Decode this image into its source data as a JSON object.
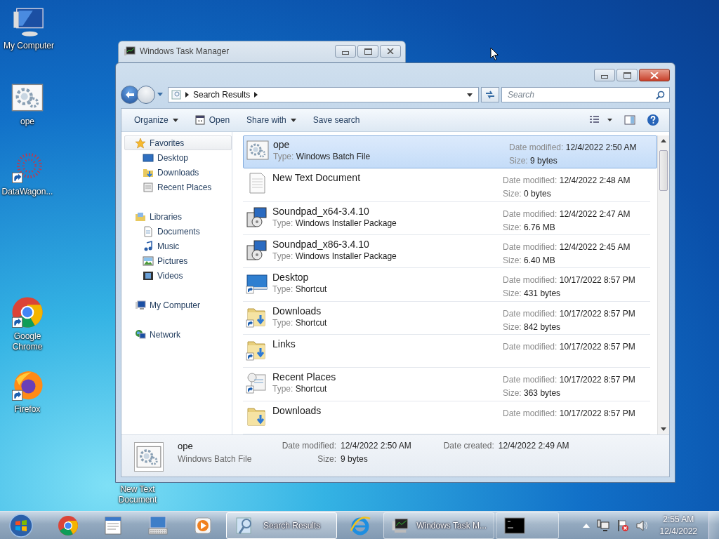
{
  "desktop": {
    "icons": [
      {
        "label": "My Computer",
        "kind": "computer"
      },
      {
        "label": "ope",
        "kind": "batch"
      },
      {
        "label": "DataWagon...",
        "kind": "dots"
      },
      {
        "label": "Google Chrome",
        "kind": "chrome"
      },
      {
        "label": "Firefox",
        "kind": "firefox"
      },
      {
        "label": "New Text Document"
      }
    ]
  },
  "task_manager": {
    "title": "Windows Task Manager"
  },
  "explorer": {
    "address": "Search Results",
    "search": {
      "placeholder": "Search"
    },
    "toolbar": [
      {
        "label": "Organize",
        "kind": "menu"
      },
      {
        "label": "Open",
        "kind": "icon"
      },
      {
        "label": "Share with",
        "kind": "menu"
      },
      {
        "label": "Save search",
        "kind": "plain"
      }
    ],
    "nav": [
      {
        "label": "Favorites",
        "kind": "star",
        "selected": true,
        "children": [
          {
            "label": "Desktop",
            "kind": "desktop",
            "selected": false
          },
          {
            "label": "Downloads",
            "kind": "downloads",
            "selected": false
          },
          {
            "label": "Recent Places",
            "kind": "recent",
            "selected": false
          }
        ]
      },
      {
        "label": "Libraries",
        "kind": "library",
        "selected": false,
        "children": [
          {
            "label": "Documents",
            "kind": "document",
            "selected": false
          },
          {
            "label": "Music",
            "kind": "music",
            "selected": false
          },
          {
            "label": "Pictures",
            "kind": "pictures",
            "selected": false
          },
          {
            "label": "Videos",
            "kind": "videos",
            "selected": false
          }
        ]
      },
      {
        "label": "My Computer",
        "kind": "computer",
        "selected": false
      },
      {
        "label": "Network",
        "kind": "network",
        "selected": false
      }
    ],
    "files": [
      {
        "name": "ope",
        "kind": "batch",
        "selected": true,
        "info": [
          {
            "label": "Type:",
            "value": "Windows Batch File"
          }
        ],
        "meta": [
          {
            "label": "Date modified:",
            "value": "12/4/2022 2:50 AM"
          },
          {
            "label": "Size:",
            "value": "9 bytes"
          }
        ]
      },
      {
        "name": "New Text Document",
        "kind": "textdoc",
        "selected": false,
        "meta": [
          {
            "label": "Date modified:",
            "value": "12/4/2022 2:48 AM"
          },
          {
            "label": "Size:",
            "value": "0 bytes"
          }
        ]
      },
      {
        "name": "Soundpad_x64-3.4.10",
        "kind": "installer",
        "selected": false,
        "info": [
          {
            "label": "Type:",
            "value": "Windows Installer Package"
          }
        ],
        "meta": [
          {
            "label": "Date modified:",
            "value": "12/4/2022 2:47 AM"
          },
          {
            "label": "Size:",
            "value": "6.76 MB"
          }
        ]
      },
      {
        "name": "Soundpad_x86-3.4.10",
        "kind": "installer",
        "selected": false,
        "info": [
          {
            "label": "Type:",
            "value": "Windows Installer Package"
          }
        ],
        "meta": [
          {
            "label": "Date modified:",
            "value": "12/4/2022 2:45 AM"
          },
          {
            "label": "Size:",
            "value": "6.40 MB"
          }
        ]
      },
      {
        "name": "Desktop",
        "kind": "desktop",
        "selected": false,
        "info": [
          {
            "label": "Type:",
            "value": "Shortcut"
          }
        ],
        "meta": [
          {
            "label": "Date modified:",
            "value": "10/17/2022 8:57 PM"
          },
          {
            "label": "Size:",
            "value": "431 bytes"
          }
        ]
      },
      {
        "name": "Downloads",
        "kind": "downloads",
        "selected": false,
        "info": [
          {
            "label": "Type:",
            "value": "Shortcut"
          }
        ],
        "meta": [
          {
            "label": "Date modified:",
            "value": "10/17/2022 8:57 PM"
          },
          {
            "label": "Size:",
            "value": "842 bytes"
          }
        ]
      },
      {
        "name": "Links",
        "kind": "links",
        "selected": false,
        "meta": [
          {
            "label": "Date modified:",
            "value": "10/17/2022 8:57 PM"
          }
        ]
      },
      {
        "name": "Recent Places",
        "kind": "recent",
        "selected": false,
        "info": [
          {
            "label": "Type:",
            "value": "Shortcut"
          }
        ],
        "meta": [
          {
            "label": "Date modified:",
            "value": "10/17/2022 8:57 PM"
          },
          {
            "label": "Size:",
            "value": "363 bytes"
          }
        ]
      },
      {
        "name": "Downloads",
        "kind": "folderdown",
        "selected": false,
        "meta": [
          {
            "label": "Date modified:",
            "value": "10/17/2022 8:57 PM"
          }
        ]
      }
    ],
    "details_pane": {
      "name": "ope",
      "type": "Windows Batch File",
      "kind": "batch",
      "fields": [
        {
          "label": "Date modified:",
          "value": "12/4/2022 2:50 AM"
        },
        {
          "label": "Size:",
          "value": "9 bytes"
        },
        {
          "label": "Date created:",
          "value": "12/4/2022 2:49 AM"
        }
      ]
    }
  },
  "taskbar": {
    "items": [
      {
        "kind": "start",
        "selected": false
      },
      {
        "kind": "chrome",
        "selected": false
      },
      {
        "kind": "wordpad",
        "selected": false
      },
      {
        "kind": "keyboard",
        "selected": false
      },
      {
        "kind": "media",
        "selected": false
      },
      {
        "kind": "explorer",
        "label": "Search Results",
        "selected": true
      },
      {
        "kind": "ie",
        "selected": false
      },
      {
        "kind": "taskmgr",
        "label": "Windows Task M...",
        "selected": false
      },
      {
        "kind": "cmd",
        "selected": false
      }
    ],
    "clock": {
      "time": "2:55 AM",
      "date": "12/4/2022"
    }
  }
}
